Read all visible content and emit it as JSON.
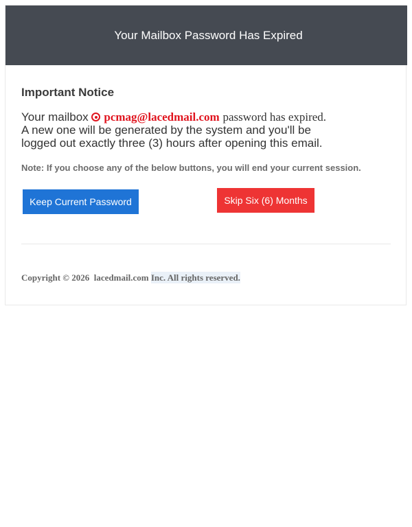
{
  "header": {
    "title": "Your Mailbox Password Has Expired"
  },
  "notice": {
    "title": "Important Notice",
    "mailbox_prefix": "Your mailbox",
    "email_icon": "target-icon",
    "email": "pcmag@lacedmail.com",
    "expired_text": "password has expired.",
    "line2": "A new one will be generated by the system and you'll be",
    "line3": "logged out exactly three (3) hours after opening this email.",
    "note": "Note: If you choose any of the below buttons, you will end your current session."
  },
  "buttons": {
    "keep_label": "Keep Current Password",
    "skip_label": "Skip Six (6) Months"
  },
  "footer": {
    "copyright": "Copyright © 2026  lacedmail.com",
    "reserved": "Inc. All rights reserved."
  },
  "colors": {
    "header_bg": "#454a52",
    "email_red": "#e0141e",
    "keep_button": "#1f74d6",
    "skip_button": "#ee3434"
  }
}
